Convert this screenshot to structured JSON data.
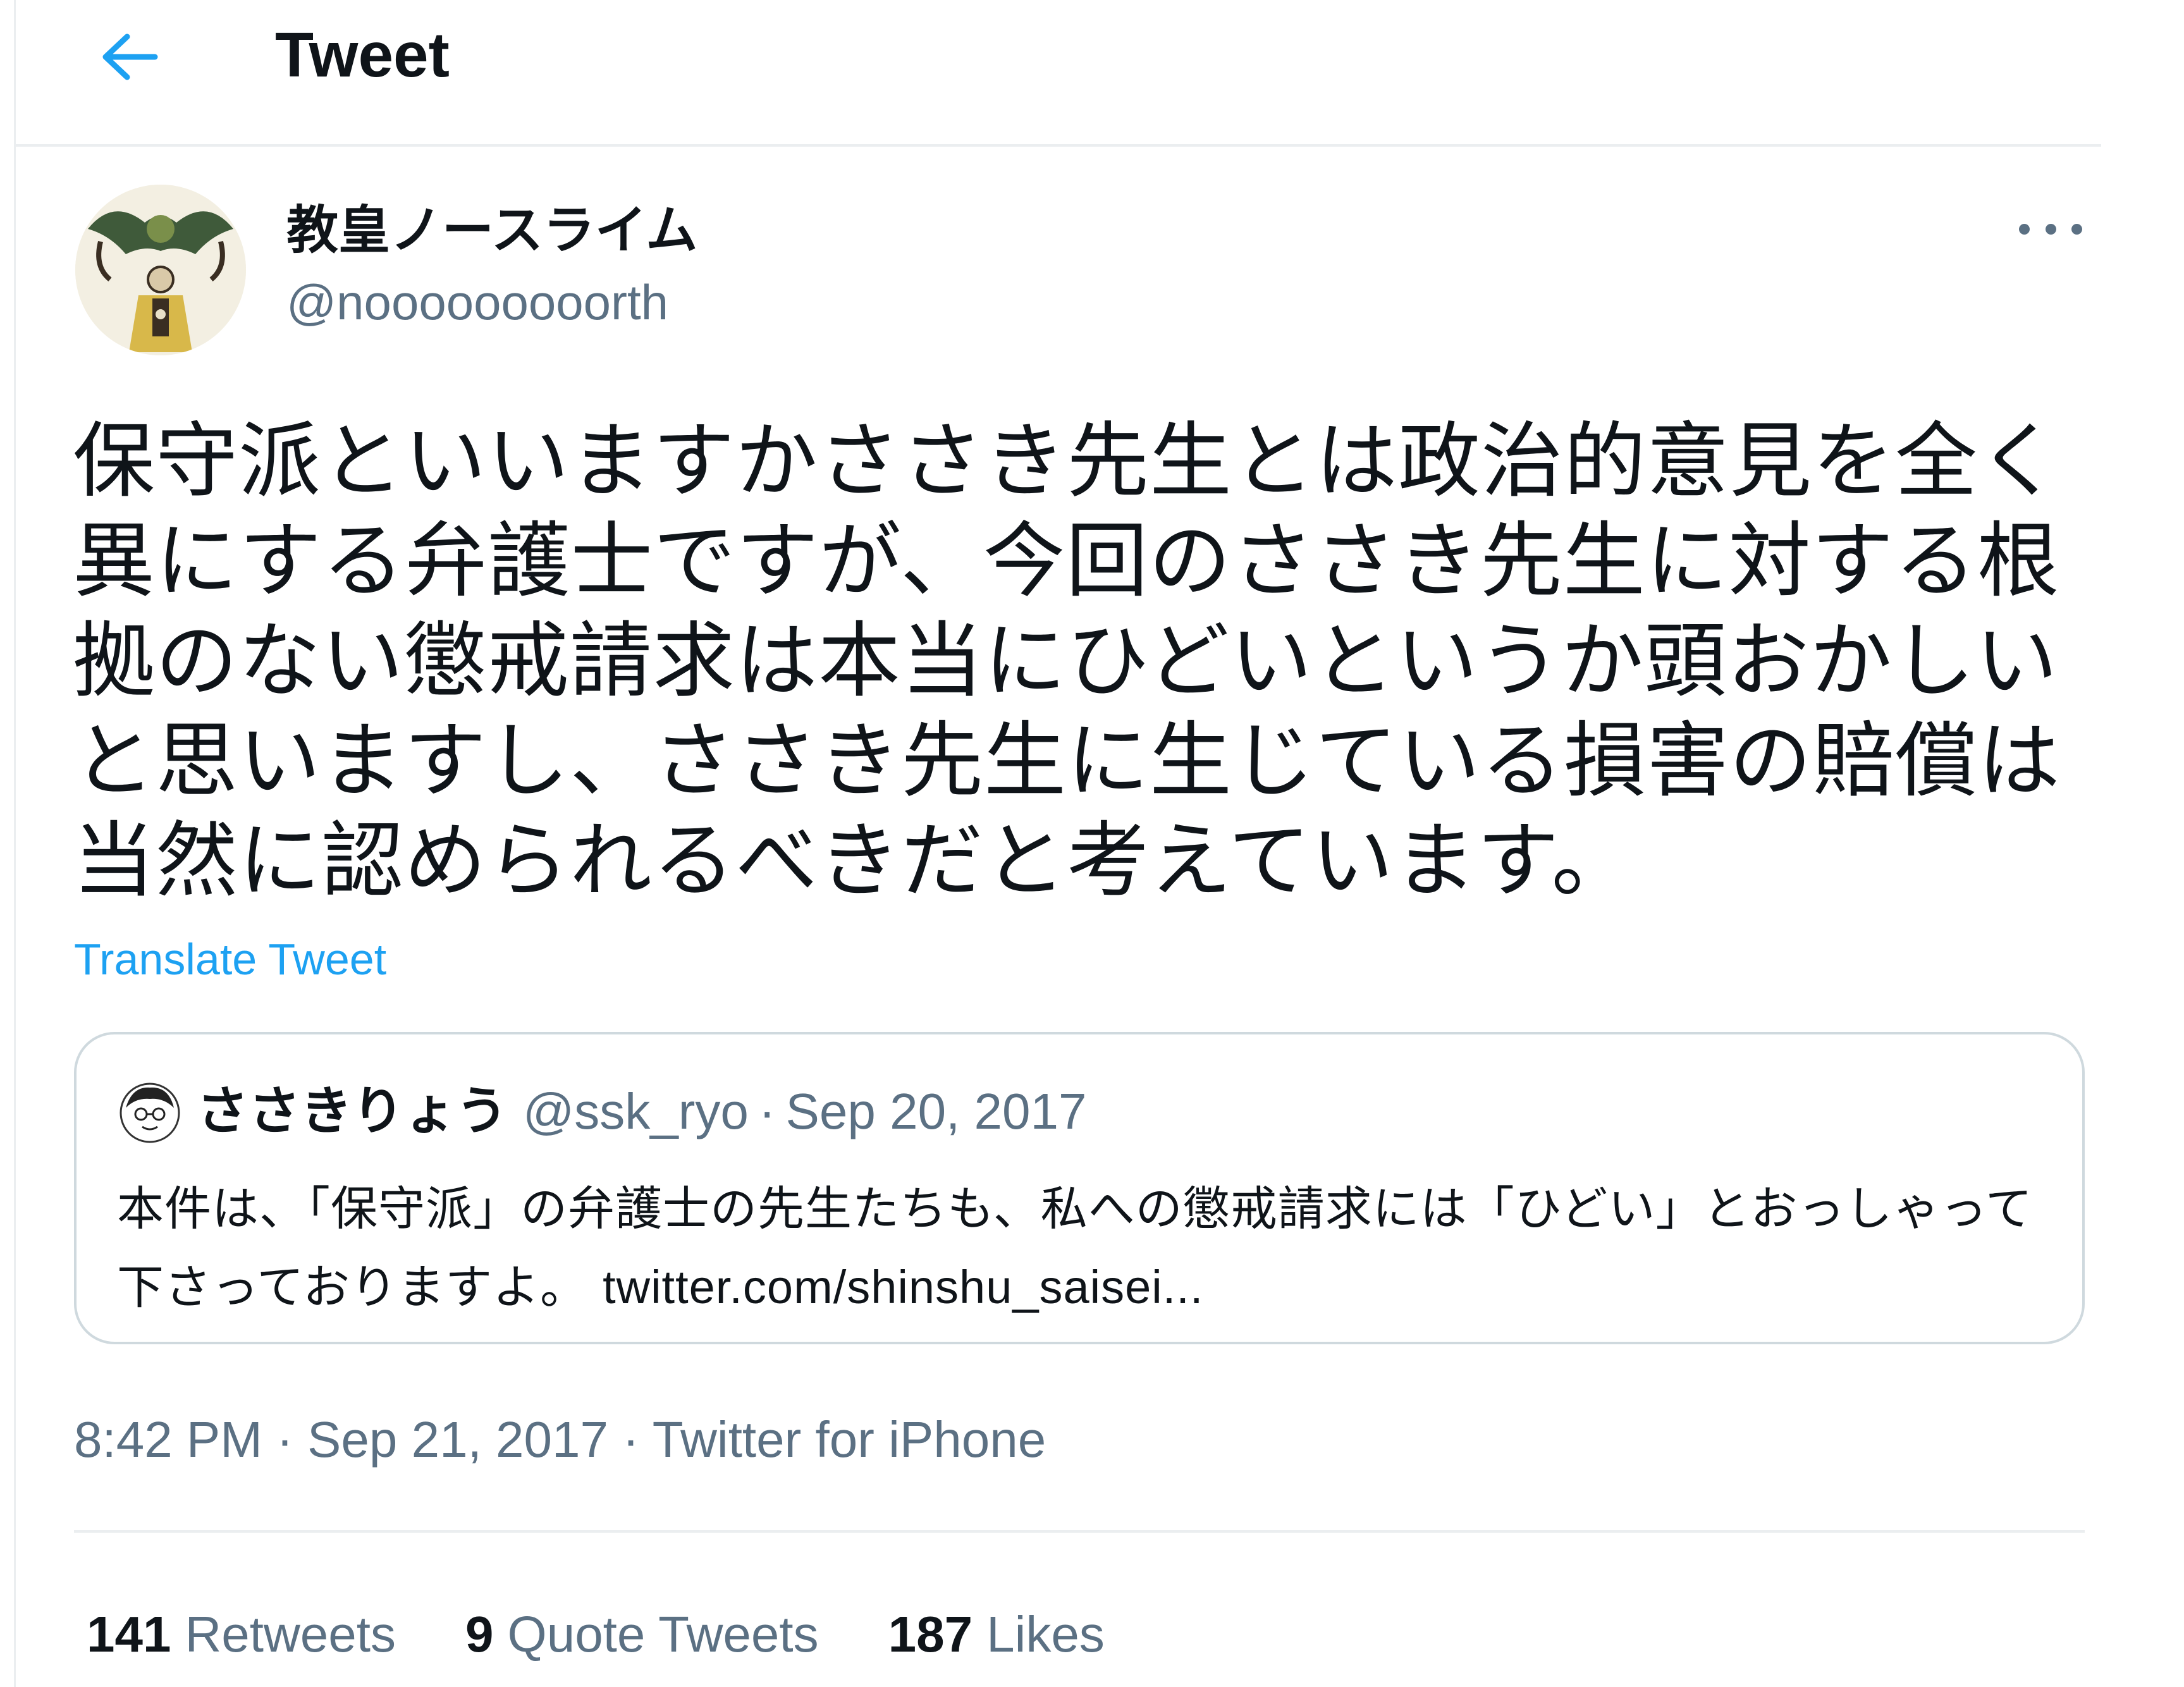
{
  "header": {
    "title": "Tweet",
    "back_icon": "arrow-left-icon",
    "accent_color": "#1da1f2"
  },
  "tweet": {
    "author": {
      "display_name": "教皇ノースライム",
      "handle": "@nooooooooorth",
      "avatar_icon": "pope-figure-avatar"
    },
    "more_icon": "more-horizontal-icon",
    "text": "保守派といいますかささき先生とは政治的意見を全く異にする弁護士ですが、今回のささき先生に対する根拠のない懲戒請求は本当にひどいというか頭おかしいと思いますし、ささき先生に生じている損害の賠償は当然に認められるべきだと考えています。",
    "translate_label": "Translate Tweet",
    "timestamp": {
      "time": "8:42 PM",
      "separator": "·",
      "date": "Sep 21, 2017",
      "client": "Twitter for iPhone"
    },
    "stats": {
      "retweets_count": "141",
      "retweets_label": "Retweets",
      "quotes_count": "9",
      "quotes_label": "Quote Tweets",
      "likes_count": "187",
      "likes_label": "Likes"
    }
  },
  "quoted_tweet": {
    "display_name": "ささきりょう",
    "handle": "@ssk_ryo",
    "separator": "·",
    "date": "Sep 20, 2017",
    "text": "本件は、「保守派」の弁護士の先生たちも、私への懲戒請求には「ひどい」とおっしゃって下さっておりますよ。",
    "link": "twitter.com/shinshu_saisei...",
    "avatar_icon": "cartoon-face-avatar"
  },
  "colors": {
    "text_primary": "#0f1419",
    "text_secondary": "#5b7083",
    "border": "#cfd9de",
    "divider": "#ebeef0",
    "link": "#1da1f2"
  }
}
